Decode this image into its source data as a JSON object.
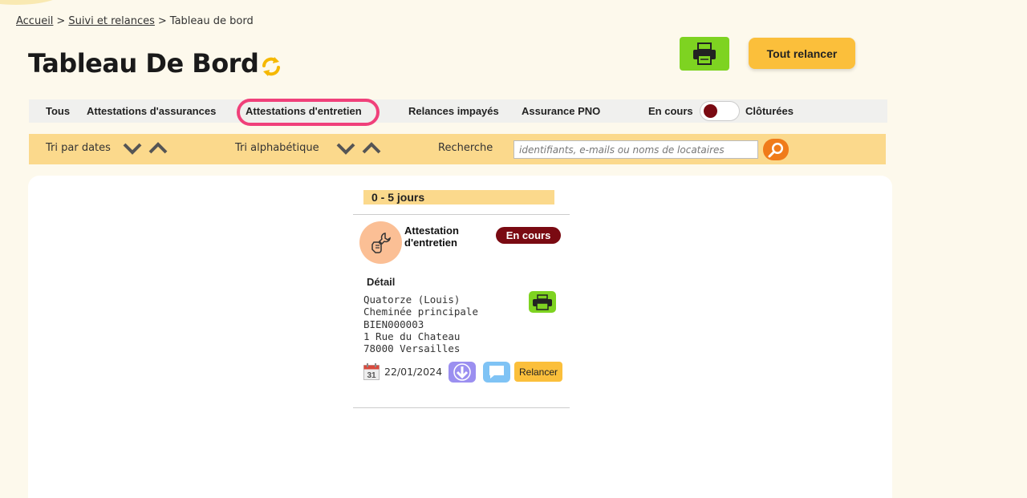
{
  "breadcrumb": {
    "home": "Accueil",
    "sep1": ">",
    "section": "Suivi et relances",
    "sep2": ">",
    "current": "Tableau de bord"
  },
  "page": {
    "title": "Tableau De Bord"
  },
  "actions": {
    "relaunch_all": "Tout relancer"
  },
  "filters": {
    "tabs": [
      "Tous",
      "Attestations d'assurances",
      "Attestations d'entretien",
      "Relances impayés",
      "Assurance PNO"
    ],
    "active_tab": "Attestations d'entretien",
    "toggle_left": "En cours",
    "toggle_right": "Clôturées"
  },
  "sort": {
    "by_date": "Tri par dates",
    "alphabetical": "Tri alphabétique",
    "search_label": "Recherche",
    "search_placeholder": "identifiants, e-mails ou noms de locataires"
  },
  "group": {
    "label": "0 - 5 jours"
  },
  "card": {
    "title": "Attestation d'entretien",
    "status": "En cours",
    "detail_label": "Détail",
    "lines": [
      "Quatorze (Louis)",
      "Cheminée principale",
      "BIEN000003",
      "1 Rue du Chateau",
      "78000 Versailles"
    ],
    "calendar_day": "31",
    "date": "22/01/2024",
    "relance": "Relancer"
  },
  "colors": {
    "accent_yellow": "#fbbf3b",
    "print_green": "#7ed321",
    "status_red": "#7a0a12",
    "active_ring": "#f0407a"
  }
}
